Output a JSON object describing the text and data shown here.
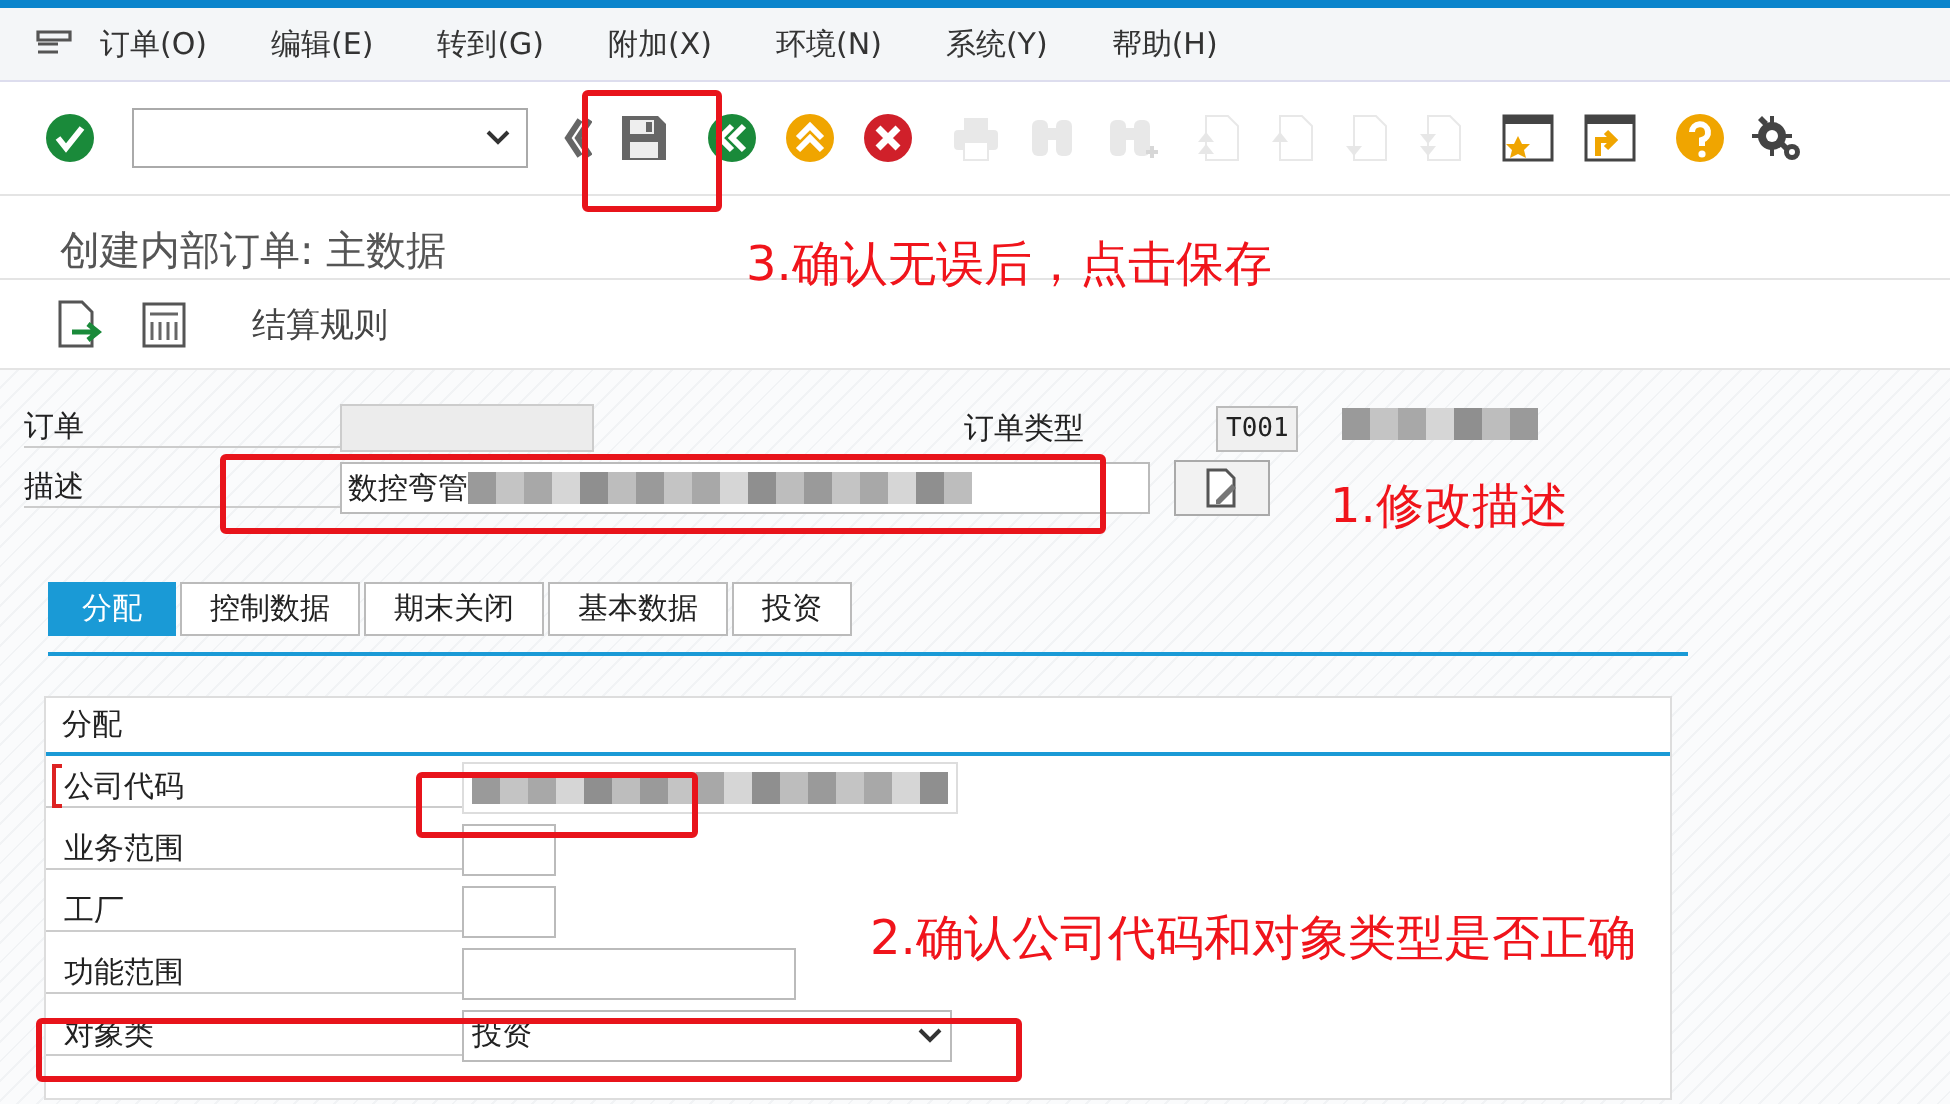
{
  "menu": [
    {
      "label": "订单(O)"
    },
    {
      "label": "编辑(E)"
    },
    {
      "label": "转到(G)"
    },
    {
      "label": "附加(X)"
    },
    {
      "label": "环境(N)"
    },
    {
      "label": "系统(Y)"
    },
    {
      "label": "帮助(H)"
    }
  ],
  "toolbar": {
    "groups": [
      [
        {
          "kind": "enter",
          "disabled": false
        }
      ],
      [
        {
          "kind": "command-field"
        }
      ],
      [
        {
          "kind": "collapse",
          "disabled": false
        },
        {
          "kind": "save",
          "disabled": false
        }
      ],
      [
        {
          "kind": "back",
          "disabled": false
        },
        {
          "kind": "exit",
          "disabled": false
        },
        {
          "kind": "cancel",
          "disabled": false
        }
      ],
      [
        {
          "kind": "print",
          "disabled": true
        },
        {
          "kind": "find",
          "disabled": true
        },
        {
          "kind": "find-next",
          "disabled": true
        }
      ],
      [
        {
          "kind": "first-page",
          "disabled": true
        },
        {
          "kind": "prev-page",
          "disabled": true
        },
        {
          "kind": "next-page",
          "disabled": true
        },
        {
          "kind": "last-page",
          "disabled": true
        }
      ],
      [
        {
          "kind": "new-session",
          "disabled": false
        },
        {
          "kind": "shortcut",
          "disabled": false
        }
      ],
      [
        {
          "kind": "help",
          "disabled": false
        },
        {
          "kind": "settings",
          "disabled": false
        }
      ]
    ]
  },
  "title": "创建内部订单: 主数据",
  "app_toolbar": {
    "icons": [
      {
        "kind": "export"
      },
      {
        "kind": "calculator"
      }
    ],
    "label": "结算规则"
  },
  "header": {
    "order": {
      "label": "订单"
    },
    "order_type": {
      "label": "订单类型",
      "value": "T001"
    },
    "description": {
      "label": "描述",
      "value": "数控弯管"
    }
  },
  "tabs": [
    {
      "label": "分配",
      "selected": true
    },
    {
      "label": "控制数据",
      "selected": false
    },
    {
      "label": "期末关闭",
      "selected": false
    },
    {
      "label": "基本数据",
      "selected": false
    },
    {
      "label": "投资",
      "selected": false
    }
  ],
  "group": {
    "title": "分配",
    "fields": [
      {
        "label": "公司代码",
        "kind": "text",
        "required": true,
        "redacted": true
      },
      {
        "label": "业务范围",
        "kind": "short",
        "required": false,
        "redacted": false
      },
      {
        "label": "工厂",
        "kind": "short",
        "required": false,
        "redacted": false
      },
      {
        "label": "功能范围",
        "kind": "medium",
        "required": false,
        "redacted": false
      },
      {
        "label": "对象类",
        "kind": "dropdown",
        "value": "投资",
        "required": false,
        "redacted": false
      }
    ]
  },
  "annotations": [
    {
      "text": "3.确认无误后，点击保存"
    },
    {
      "text": "1.修改描述"
    },
    {
      "text": "2.确认公司代码和对象类型是否正确"
    }
  ]
}
